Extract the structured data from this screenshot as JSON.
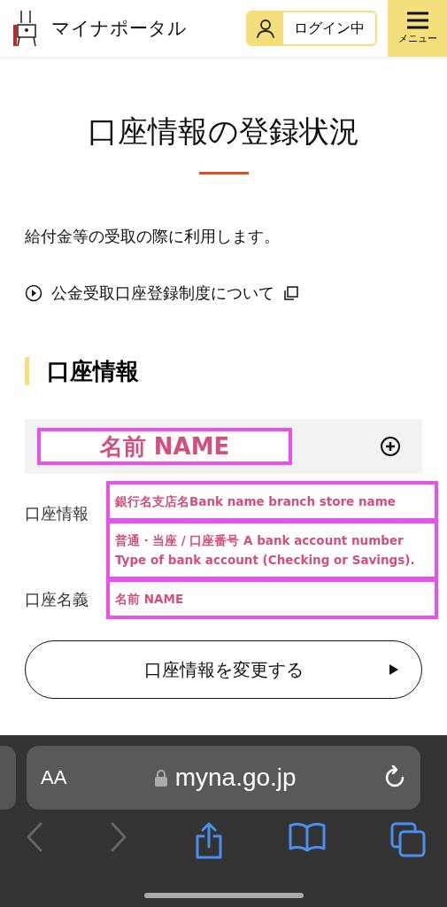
{
  "header": {
    "logo_text": "マイナポータル",
    "login": "ログイン中",
    "menu": "メニュー"
  },
  "page": {
    "title": "口座情報の登録状況",
    "intro": "給付金等の受取の際に利用します。",
    "link": "公金受取口座登録制度について",
    "section": "口座情報"
  },
  "accordion": {
    "title": "名前 NAME",
    "expanded": false
  },
  "rows": [
    {
      "label": "口座情報",
      "values": [
        "銀行名支店名Bank name branch store name",
        "普通・当座 / 口座番号 A bank account number Type of bank account (Checking or Savings)."
      ]
    },
    {
      "label": "口座名義",
      "values": [
        "名前 NAME"
      ]
    }
  ],
  "change_button": "口座情報を変更する",
  "browser": {
    "text_size": "AA",
    "url": "myna.go.jp"
  }
}
